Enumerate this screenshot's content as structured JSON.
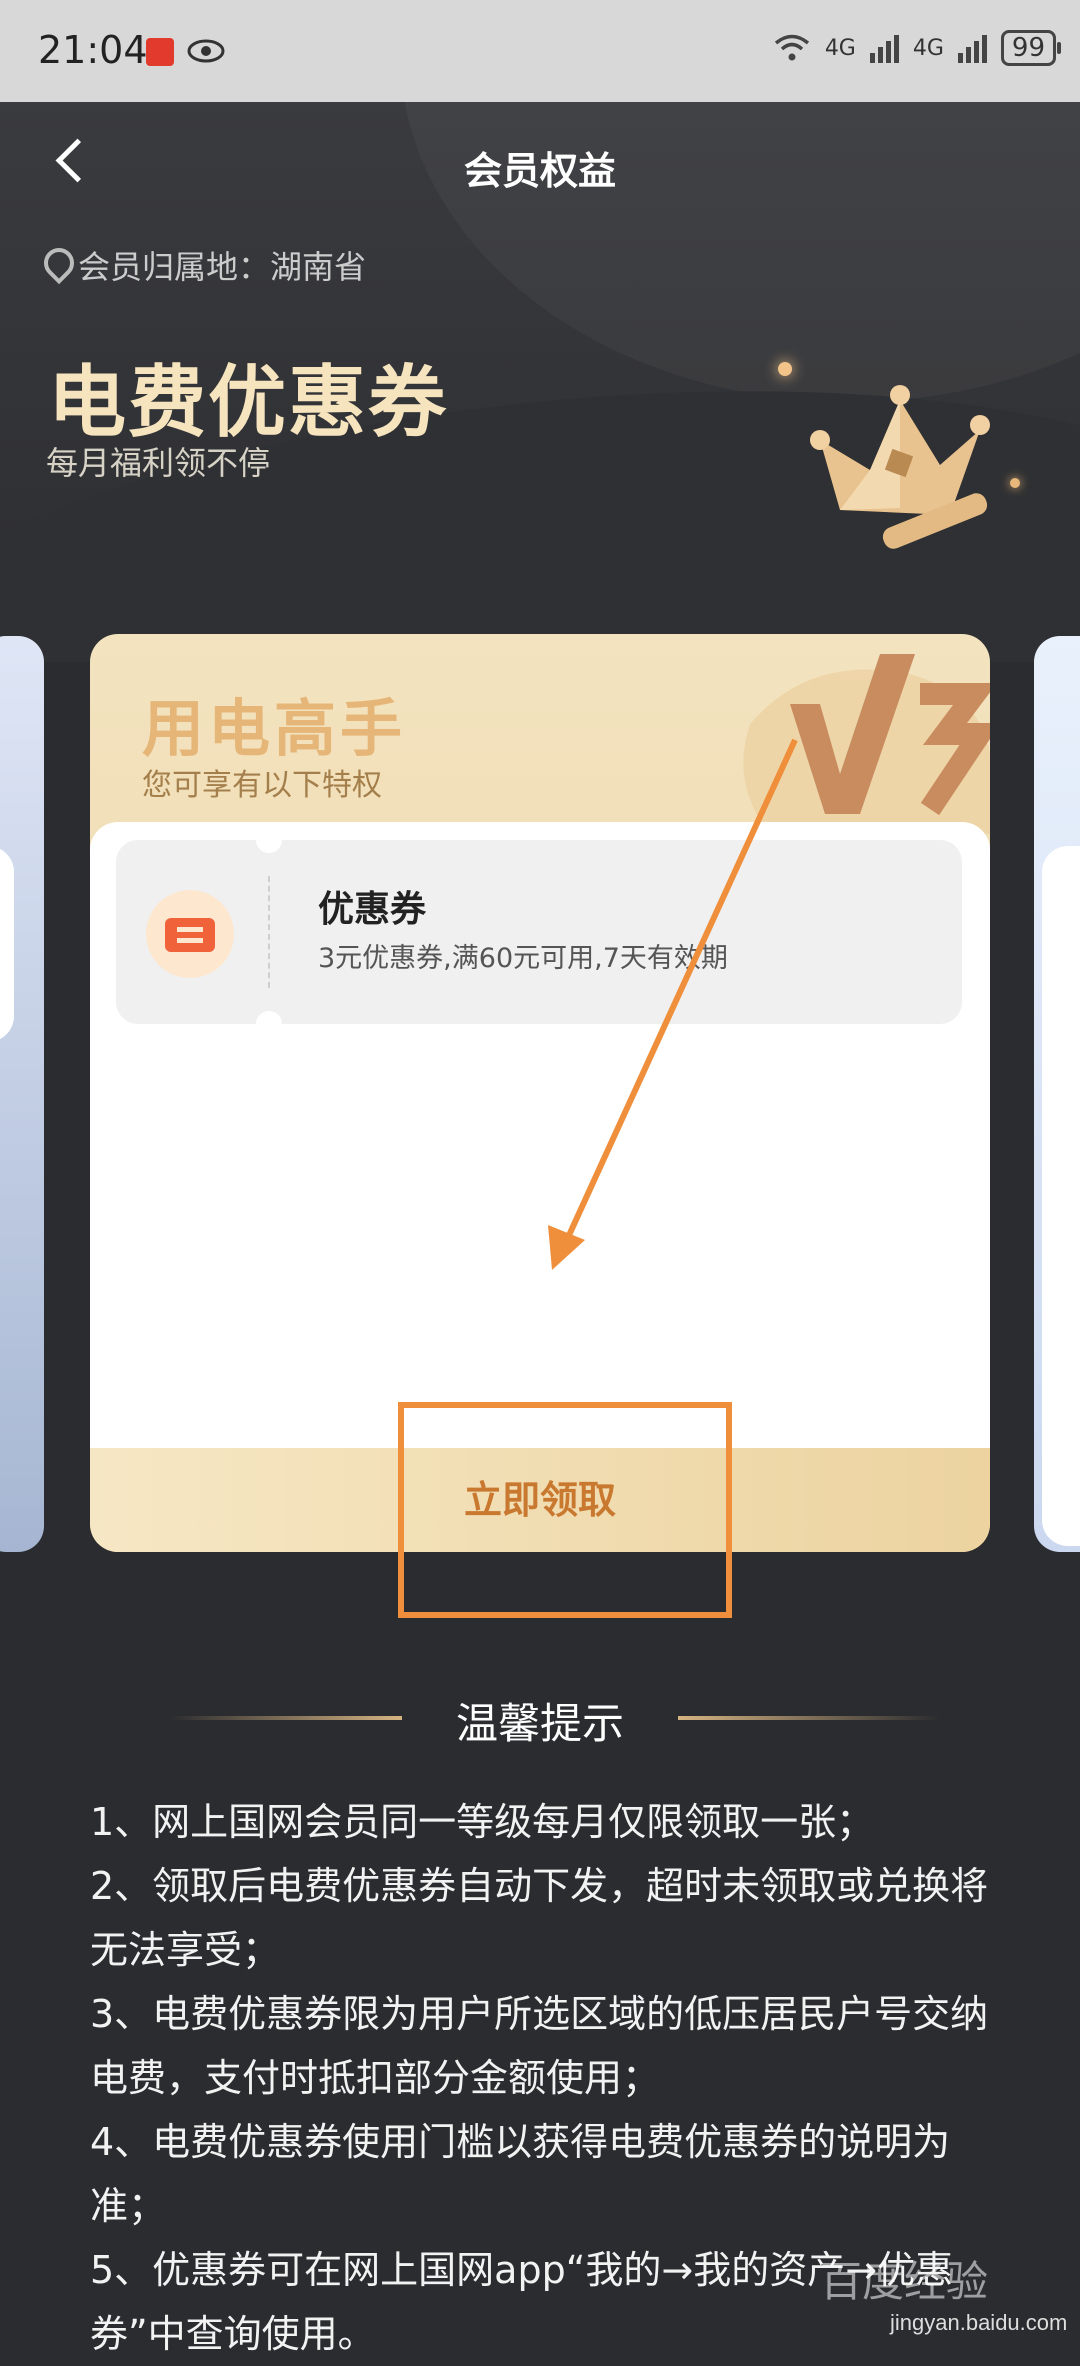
{
  "status_bar": {
    "time": "21:04",
    "network_1": "4G",
    "network_2": "4G",
    "battery": "99"
  },
  "header": {
    "title": "会员权益",
    "location": "会员归属地：湖南省",
    "big_title": "电费优惠券",
    "subtitle": "每月福利领不停"
  },
  "card": {
    "title": "用电高手",
    "subtitle": "您可享有以下特权",
    "coupon": {
      "name": "优惠券",
      "desc": "3元优惠券,满60元可用,7天有效期"
    },
    "claim_label": "立即领取"
  },
  "tips": {
    "title": "温馨提示",
    "items": [
      "1、网上国网会员同一等级每月仅限领取一张；",
      "2、领取后电费优惠券自动下发，超时未领取或兑换将无法享受；",
      "3、电费优惠券限为用户所选区域的低压居民户号交纳电费，支付时抵扣部分金额使用；",
      "4、电费优惠券使用门槛以获得电费优惠券的说明为准；",
      "5、优惠券可在网上国网app“我的→我的资产→优惠券”中查询使用。"
    ]
  },
  "watermark": {
    "text": "百度经验",
    "url": "jingyan.baidu.com"
  },
  "colors": {
    "accent": "#c9782f",
    "annotation": "#ef8f3c",
    "title_gold": "#f6e4bf"
  }
}
